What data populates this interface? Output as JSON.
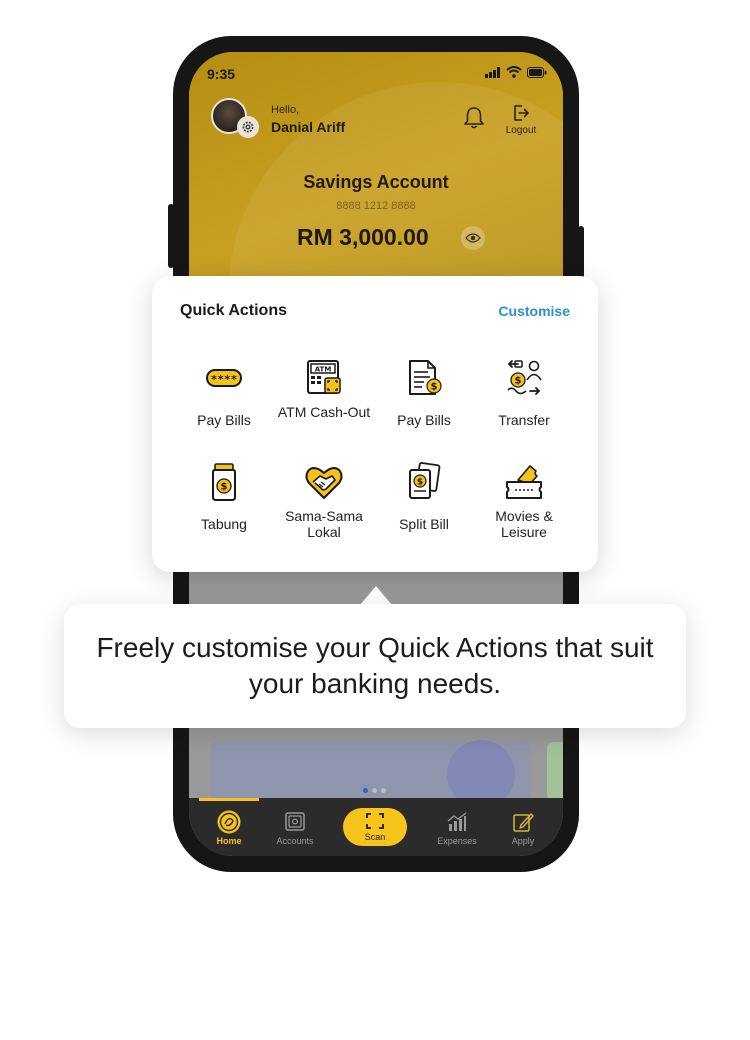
{
  "status_bar": {
    "time": "9:35",
    "icons": [
      "signal-icon",
      "wifi-icon",
      "battery-icon"
    ]
  },
  "header": {
    "greeting": "Hello,",
    "user_name": "Danial Ariff",
    "logout_label": "Logout"
  },
  "account": {
    "title": "Savings Account",
    "number": "8888 1212 8888",
    "balance": "RM 3,000.00"
  },
  "quick_actions": {
    "title": "Quick Actions",
    "customise_label": "Customise",
    "items": [
      {
        "label": "Pay Bills",
        "icon": "card-icon"
      },
      {
        "label": "ATM Cash-Out",
        "icon": "atm-icon"
      },
      {
        "label": "Pay Bills",
        "icon": "bill-icon"
      },
      {
        "label": "Transfer",
        "icon": "transfer-icon"
      },
      {
        "label": "Tabung",
        "icon": "jar-icon"
      },
      {
        "label": "Sama-Sama Lokal",
        "icon": "handshake-icon"
      },
      {
        "label": "Split Bill",
        "icon": "split-bill-icon"
      },
      {
        "label": "Movies & Leisure",
        "icon": "ticket-icon"
      }
    ]
  },
  "tooltip": {
    "text": "Freely customise your Quick Actions that suit your banking needs."
  },
  "bottom_nav": {
    "items": [
      {
        "label": "Home",
        "icon": "home-icon",
        "active": true
      },
      {
        "label": "Accounts",
        "icon": "safe-icon",
        "active": false
      },
      {
        "label": "Scan",
        "icon": "scan-icon",
        "active": false
      },
      {
        "label": "Expenses",
        "icon": "chart-icon",
        "active": false
      },
      {
        "label": "Apply",
        "icon": "apply-icon",
        "active": false
      }
    ]
  },
  "colors": {
    "accent": "#F6C21A",
    "link": "#2E8FD6",
    "nav_bg": "#2B2B2B"
  },
  "carousel": {
    "page_count": 3,
    "active_page": 1
  }
}
